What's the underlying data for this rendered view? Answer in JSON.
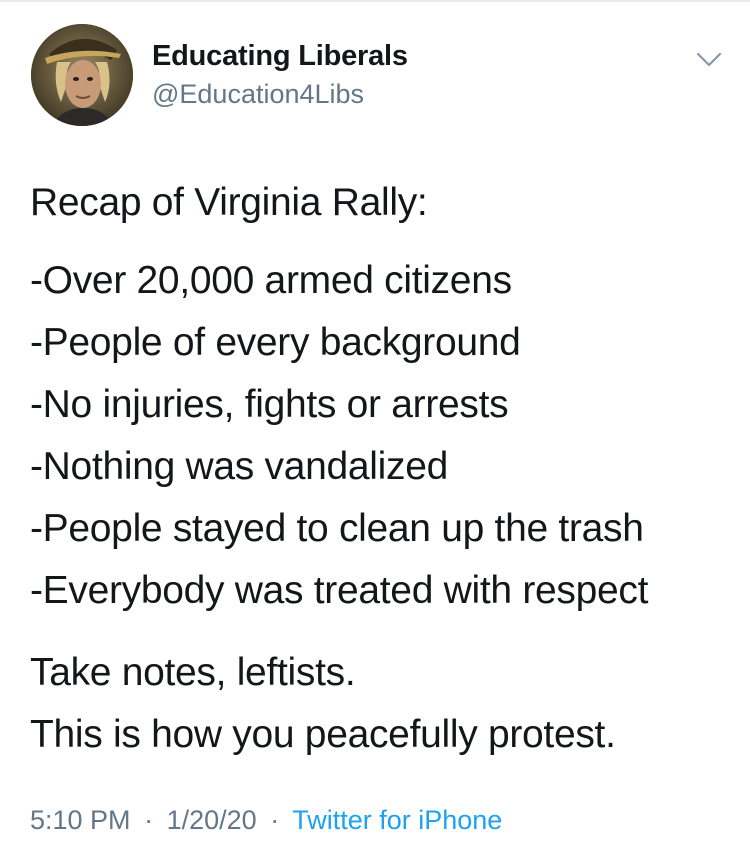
{
  "user": {
    "display_name": "Educating Liberals",
    "handle": "@Education4Libs"
  },
  "tweet": {
    "heading": "Recap of Virginia Rally:",
    "bullets": [
      "-Over 20,000 armed citizens",
      "-People of every background",
      "-No injuries, fights or arrests",
      "-Nothing was vandalized",
      "-People stayed to clean up the trash",
      "-Everybody was treated with respect"
    ],
    "closing": [
      "Take notes, leftists.",
      "This is how you peacefully protest."
    ]
  },
  "meta": {
    "time": "5:10 PM",
    "date": "1/20/20",
    "separator": "·",
    "source": "Twitter for iPhone"
  },
  "colors": {
    "text": "#14171a",
    "secondary": "#657786",
    "link": "#1da1f2"
  },
  "icons": {
    "menu": "chevron-down-icon"
  }
}
